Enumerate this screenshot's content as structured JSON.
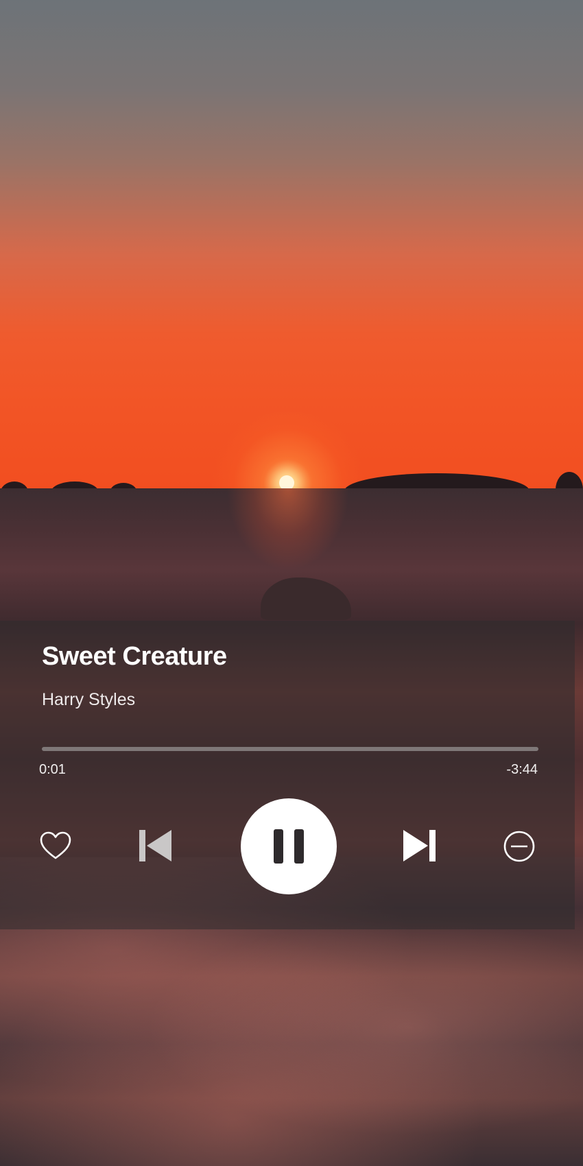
{
  "player": {
    "title": "Sweet Creature",
    "artist": "Harry Styles",
    "elapsed": "0:01",
    "remaining": "-3:44",
    "progress_fraction": 0.0,
    "state": "playing"
  },
  "controls": {
    "like_icon": "heart-outline-icon",
    "previous_icon": "skip-previous-icon",
    "play_pause_icon": "pause-icon",
    "next_icon": "skip-next-icon",
    "block_icon": "minus-circle-icon"
  },
  "colors": {
    "text": "#ffffff",
    "panel": "#302c2e",
    "track": "#969292",
    "accent": "#ffffff"
  }
}
